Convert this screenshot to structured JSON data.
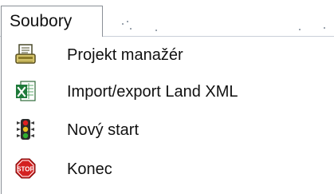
{
  "menubar": {
    "menu_title": "Soubory"
  },
  "dropdown": {
    "items": [
      {
        "label": "Projekt manažér",
        "icon": "project-manager-icon"
      },
      {
        "label": "Import/export Land XML",
        "icon": "excel-xml-icon"
      },
      {
        "label": "Nový start",
        "icon": "traffic-light-icon"
      },
      {
        "label": "Konec",
        "icon": "stop-sign-icon"
      }
    ]
  }
}
